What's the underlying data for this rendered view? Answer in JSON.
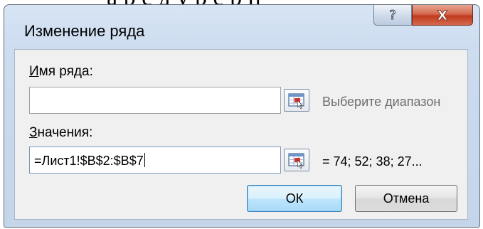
{
  "background": {
    "fragment_text": "а р е д у р е р н"
  },
  "dialog": {
    "title": "Изменение ряда",
    "help_glyph": "?",
    "close_glyph": "X",
    "colors": {
      "frame": "#cddcef",
      "close_button": "#c9472b",
      "panel": "#f0f0f0",
      "default_button_border": "#3c7fb1"
    }
  },
  "series_name": {
    "label_accel": "И",
    "label_rest": "мя ряда:",
    "value": "",
    "range_button_icon": "range-select-icon",
    "hint": "Выберите диапазон"
  },
  "series_values": {
    "label_accel": "З",
    "label_rest": "начения:",
    "value": "=Лист1!$B$2:$B$7",
    "range_button_icon": "range-select-icon",
    "preview": "= 74; 52; 38; 27..."
  },
  "buttons": {
    "ok_label": "ОК",
    "cancel_label": "Отмена"
  }
}
